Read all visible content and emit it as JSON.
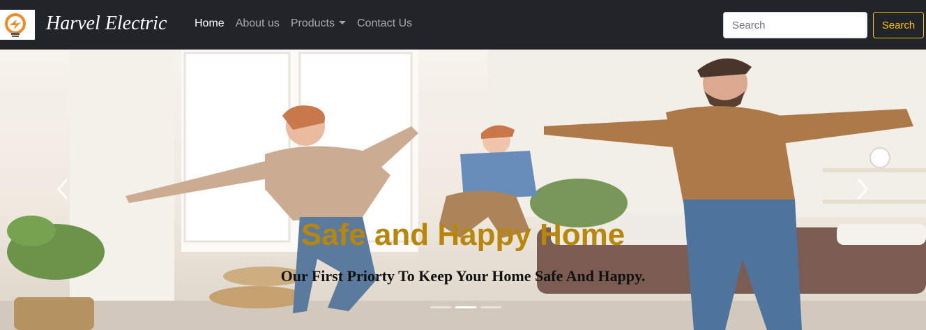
{
  "navbar": {
    "brand_name": "Harvel Electric",
    "links": [
      {
        "label": "Home",
        "active": true
      },
      {
        "label": "About us",
        "active": false
      },
      {
        "label": "Products",
        "active": false,
        "dropdown": true
      },
      {
        "label": "Contact Us",
        "active": false
      }
    ],
    "search": {
      "placeholder": "Search",
      "value": ""
    },
    "search_button": "Search"
  },
  "carousel": {
    "caption_title": "Safe and Happy Home",
    "caption_subtitle": "Our First Priorty To Keep Your Home Safe And Happy.",
    "indicator_count": 3,
    "active_slide": 2
  },
  "colors": {
    "navbar_bg": "#212529",
    "accent": "#ffc107",
    "caption_title": "#b8860b"
  },
  "icons": [
    "bulb-logo-icon",
    "chevron-left-icon",
    "chevron-right-icon",
    "caret-down-icon"
  ]
}
